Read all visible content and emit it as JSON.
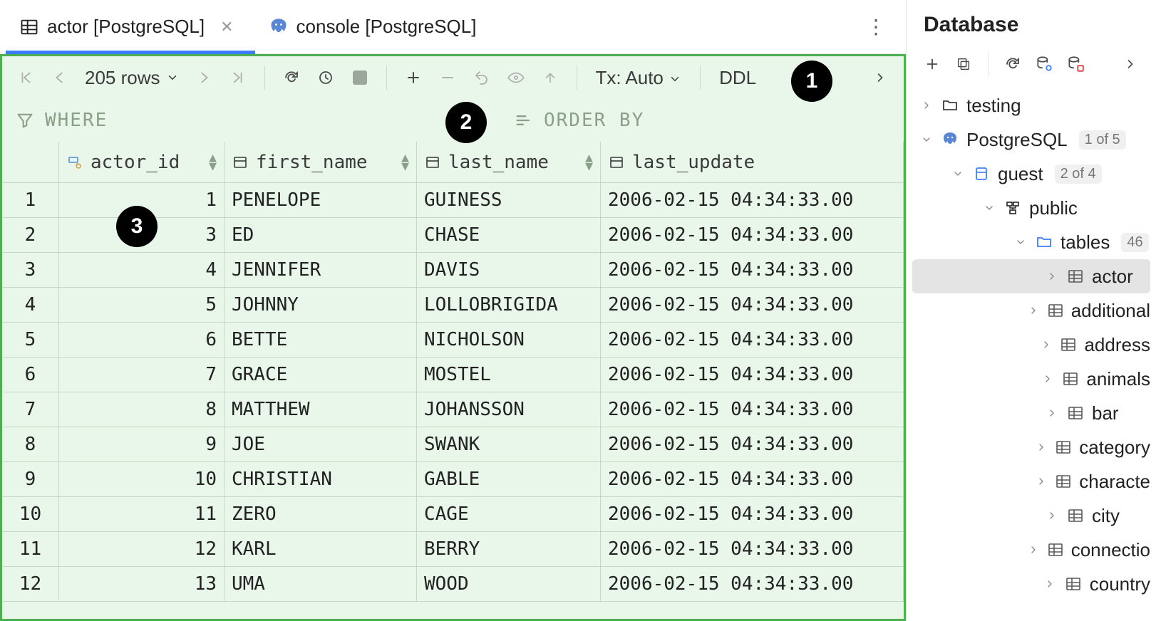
{
  "tabs": {
    "items": [
      {
        "label": "actor [PostgreSQL]",
        "kind": "table",
        "active": true
      },
      {
        "label": "console [PostgreSQL]",
        "kind": "console",
        "active": false
      }
    ]
  },
  "toolbar": {
    "row_count": "205 rows",
    "tx_label": "Tx: Auto",
    "ddl_label": "DDL"
  },
  "filter": {
    "where": "WHERE",
    "order": "ORDER BY"
  },
  "callouts": [
    "1",
    "2",
    "3"
  ],
  "grid": {
    "columns": [
      {
        "key": "actor_id",
        "label": "actor_id",
        "type": "pk"
      },
      {
        "key": "first_name",
        "label": "first_name",
        "type": "col"
      },
      {
        "key": "last_name",
        "label": "last_name",
        "type": "col"
      },
      {
        "key": "last_update",
        "label": "last_update",
        "type": "col"
      }
    ],
    "rows": [
      {
        "n": "1",
        "actor_id": "1",
        "first_name": "PENELOPE",
        "last_name": "GUINESS",
        "last_update": "2006-02-15 04:34:33.00"
      },
      {
        "n": "2",
        "actor_id": "3",
        "first_name": "ED",
        "last_name": "CHASE",
        "last_update": "2006-02-15 04:34:33.00"
      },
      {
        "n": "3",
        "actor_id": "4",
        "first_name": "JENNIFER",
        "last_name": "DAVIS",
        "last_update": "2006-02-15 04:34:33.00"
      },
      {
        "n": "4",
        "actor_id": "5",
        "first_name": "JOHNNY",
        "last_name": "LOLLOBRIGIDA",
        "last_update": "2006-02-15 04:34:33.00"
      },
      {
        "n": "5",
        "actor_id": "6",
        "first_name": "BETTE",
        "last_name": "NICHOLSON",
        "last_update": "2006-02-15 04:34:33.00"
      },
      {
        "n": "6",
        "actor_id": "7",
        "first_name": "GRACE",
        "last_name": "MOSTEL",
        "last_update": "2006-02-15 04:34:33.00"
      },
      {
        "n": "7",
        "actor_id": "8",
        "first_name": "MATTHEW",
        "last_name": "JOHANSSON",
        "last_update": "2006-02-15 04:34:33.00"
      },
      {
        "n": "8",
        "actor_id": "9",
        "first_name": "JOE",
        "last_name": "SWANK",
        "last_update": "2006-02-15 04:34:33.00"
      },
      {
        "n": "9",
        "actor_id": "10",
        "first_name": "CHRISTIAN",
        "last_name": "GABLE",
        "last_update": "2006-02-15 04:34:33.00"
      },
      {
        "n": "10",
        "actor_id": "11",
        "first_name": "ZERO",
        "last_name": "CAGE",
        "last_update": "2006-02-15 04:34:33.00"
      },
      {
        "n": "11",
        "actor_id": "12",
        "first_name": "KARL",
        "last_name": "BERRY",
        "last_update": "2006-02-15 04:34:33.00"
      },
      {
        "n": "12",
        "actor_id": "13",
        "first_name": "UMA",
        "last_name": "WOOD",
        "last_update": "2006-02-15 04:34:33.00"
      }
    ]
  },
  "database": {
    "title": "Database",
    "tree": [
      {
        "depth": 0,
        "exp": "chev-r",
        "icon": "folder",
        "label": "testing",
        "badge": ""
      },
      {
        "depth": 0,
        "exp": "chev-d",
        "icon": "pg",
        "label": "PostgreSQL",
        "badge": "1 of 5"
      },
      {
        "depth": 1,
        "exp": "chev-d",
        "icon": "db",
        "label": "guest",
        "badge": "2 of 4"
      },
      {
        "depth": 2,
        "exp": "chev-d",
        "icon": "schema",
        "label": "public",
        "badge": ""
      },
      {
        "depth": 3,
        "exp": "chev-d",
        "icon": "folderb",
        "label": "tables",
        "badge": "46"
      },
      {
        "depth": 4,
        "exp": "chev-r",
        "icon": "table",
        "label": "actor",
        "badge": "",
        "sel": true
      },
      {
        "depth": 4,
        "exp": "chev-r",
        "icon": "table",
        "label": "additional",
        "badge": ""
      },
      {
        "depth": 4,
        "exp": "chev-r",
        "icon": "table",
        "label": "address",
        "badge": ""
      },
      {
        "depth": 4,
        "exp": "chev-r",
        "icon": "table",
        "label": "animals",
        "badge": ""
      },
      {
        "depth": 4,
        "exp": "chev-r",
        "icon": "table",
        "label": "bar",
        "badge": ""
      },
      {
        "depth": 4,
        "exp": "chev-r",
        "icon": "table",
        "label": "category",
        "badge": ""
      },
      {
        "depth": 4,
        "exp": "chev-r",
        "icon": "table",
        "label": "characte",
        "badge": ""
      },
      {
        "depth": 4,
        "exp": "chev-r",
        "icon": "table",
        "label": "city",
        "badge": ""
      },
      {
        "depth": 4,
        "exp": "chev-r",
        "icon": "table",
        "label": "connectio",
        "badge": ""
      },
      {
        "depth": 4,
        "exp": "chev-r",
        "icon": "table",
        "label": "country",
        "badge": ""
      }
    ]
  }
}
